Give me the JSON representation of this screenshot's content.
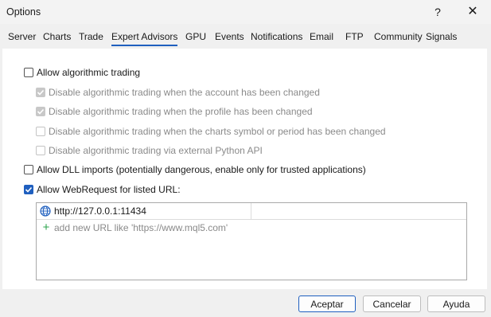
{
  "window": {
    "title": "Options",
    "help_label": "?",
    "close_label": "✕"
  },
  "tabs": [
    {
      "label": "Server"
    },
    {
      "label": "Charts"
    },
    {
      "label": "Trade"
    },
    {
      "label": "Expert Advisors"
    },
    {
      "label": "GPU"
    },
    {
      "label": "Events"
    },
    {
      "label": "Notifications"
    },
    {
      "label": "Email"
    },
    {
      "label": "FTP"
    },
    {
      "label": "Community"
    },
    {
      "label": "Signals"
    }
  ],
  "active_tab": "Expert Advisors",
  "options": {
    "allow_algo": {
      "label": "Allow algorithmic trading",
      "checked": false
    },
    "disable_account": {
      "label": "Disable algorithmic trading when the account has been changed",
      "checked": true,
      "enabled": false
    },
    "disable_profile": {
      "label": "Disable algorithmic trading when the profile has been changed",
      "checked": true,
      "enabled": false
    },
    "disable_symbol": {
      "label": "Disable algorithmic trading when the charts symbol or period has been changed",
      "checked": false,
      "enabled": false
    },
    "disable_python": {
      "label": "Disable algorithmic trading via external Python API",
      "checked": false,
      "enabled": false
    },
    "allow_dll": {
      "label": "Allow DLL imports (potentially dangerous, enable only for trusted applications)",
      "checked": false
    },
    "allow_webrequest": {
      "label": "Allow WebRequest for listed URL:",
      "checked": true
    }
  },
  "url_list": {
    "urls": [
      "http://127.0.0.1:11434"
    ],
    "add_placeholder": "add new URL like 'https://www.mql5.com'"
  },
  "buttons": {
    "ok": "Aceptar",
    "cancel": "Cancelar",
    "help": "Ayuda"
  },
  "colors": {
    "accent": "#1f5fbf",
    "add_icon": "#2da44e"
  }
}
